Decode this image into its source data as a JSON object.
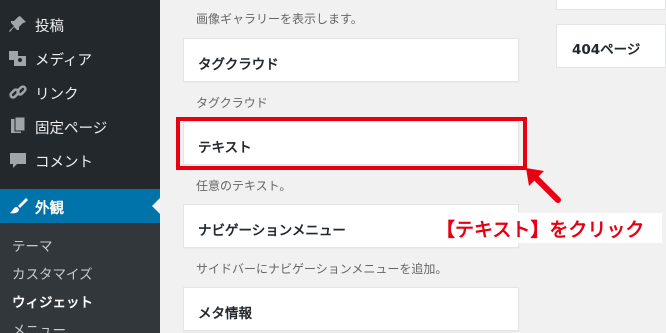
{
  "sidebar": {
    "items": [
      {
        "label": "投稿",
        "icon": "pin-icon"
      },
      {
        "label": "メディア",
        "icon": "media-icon"
      },
      {
        "label": "リンク",
        "icon": "link-icon"
      },
      {
        "label": "固定ページ",
        "icon": "page-icon"
      },
      {
        "label": "コメント",
        "icon": "comment-icon"
      },
      {
        "label": "外観",
        "icon": "brush-icon"
      }
    ],
    "submenu": [
      "テーマ",
      "カスタマイズ",
      "ウィジェット",
      "メニュー"
    ]
  },
  "widgets": {
    "gallery_desc": "画像ギャラリーを表示します。",
    "tagcloud_title": "タグクラウド",
    "tagcloud_desc": "タグクラウド",
    "text_title": "テキスト",
    "text_desc": "任意のテキスト。",
    "navmenu_title": "ナビゲーションメニュー",
    "navmenu_desc": "サイドバーにナビゲーションメニューを追加。",
    "meta_title": "メタ情報"
  },
  "right_column": {
    "widget_404": "404ページ"
  },
  "annotation": "【テキスト】をクリック",
  "colors": {
    "sidebar_bg": "#23282d",
    "submenu_bg": "#32373c",
    "current_bg": "#0073aa",
    "highlight_red": "#e60012"
  }
}
